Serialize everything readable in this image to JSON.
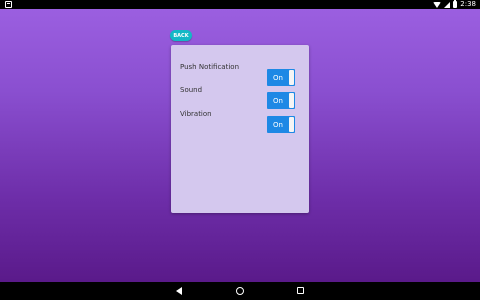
{
  "status_bar": {
    "time": "2:38"
  },
  "back_button": {
    "label": "BACK"
  },
  "settings": [
    {
      "label": "Push Notification",
      "toggle_label": "On"
    },
    {
      "label": "Sound",
      "toggle_label": "On"
    },
    {
      "label": "Vibration",
      "toggle_label": "On"
    }
  ],
  "colors": {
    "toggle_on": "#1e88e5",
    "back_button": "#14b8c6",
    "card": "#d4c8ee"
  },
  "icons": {
    "status_left": "notification-icon",
    "wifi": "wifi-icon",
    "signal": "signal-icon",
    "battery": "battery-icon",
    "nav_back": "nav-back-icon",
    "nav_home": "nav-home-icon",
    "nav_recents": "nav-recents-icon"
  }
}
